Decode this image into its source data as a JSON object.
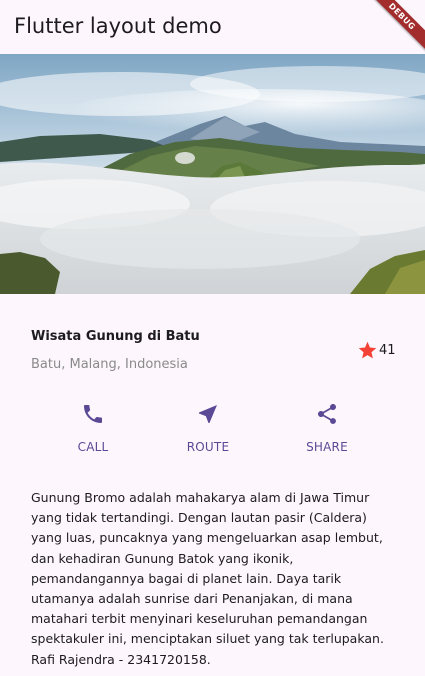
{
  "appbar": {
    "title": "Flutter layout demo",
    "debug_banner": "DEBUG"
  },
  "place": {
    "title": "Wisata Gunung di Batu",
    "location": "Batu, Malang, Indonesia",
    "rating_count": "41",
    "star_color": "#f44336"
  },
  "actions": [
    {
      "label": "CALL",
      "icon": "phone-icon"
    },
    {
      "label": "ROUTE",
      "icon": "near-me-icon"
    },
    {
      "label": "SHARE",
      "icon": "share-icon"
    }
  ],
  "accent_color": "#5a4a96",
  "description": "Gunung Bromo adalah mahakarya alam di Jawa Timur yang tidak tertandingi. Dengan lautan pasir (Caldera) yang luas, puncaknya yang mengeluarkan asap lembut, dan kehadiran Gunung Batok yang ikonik, pemandangannya bagai di planet lain. Daya tarik utamanya adalah sunrise dari Penanjakan, di mana matahari terbit menyinari keseluruhan pemandangan spektakuler ini, menciptakan siluet yang tak terlupakan. Rafi Rajendra - 2341720158."
}
